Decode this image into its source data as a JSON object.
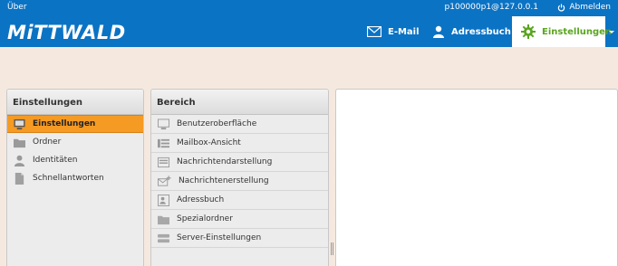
{
  "topbar": {
    "about": "Über",
    "user": "p100000p1@127.0.0.1",
    "logout": "Abmelden",
    "logo": "MiTTWALD"
  },
  "nav": {
    "mail": "E-Mail",
    "addressbook": "Adressbuch",
    "settings": "Einstellungen"
  },
  "sections": {
    "title": "Einstellungen",
    "items": [
      {
        "label": "Einstellungen",
        "icon": "monitor-icon",
        "selected": true
      },
      {
        "label": "Ordner",
        "icon": "folder-icon",
        "selected": false
      },
      {
        "label": "Identitäten",
        "icon": "person-icon",
        "selected": false
      },
      {
        "label": "Schnellantworten",
        "icon": "document-icon",
        "selected": false
      }
    ]
  },
  "area": {
    "title": "Bereich",
    "items": [
      {
        "label": "Benutzeroberfläche",
        "icon": "monitor-icon"
      },
      {
        "label": "Mailbox-Ansicht",
        "icon": "list-icon"
      },
      {
        "label": "Nachrichtendarstellung",
        "icon": "message-view-icon"
      },
      {
        "label": "Nachrichtenerstellung",
        "icon": "compose-icon"
      },
      {
        "label": "Adressbuch",
        "icon": "addressbook-icon"
      },
      {
        "label": "Spezialordner",
        "icon": "folder-icon"
      },
      {
        "label": "Server-Einstellungen",
        "icon": "server-icon"
      }
    ]
  },
  "colors": {
    "brand": "#0b73c4",
    "selected": "#f59a23",
    "settings_active": "#5aa520"
  }
}
